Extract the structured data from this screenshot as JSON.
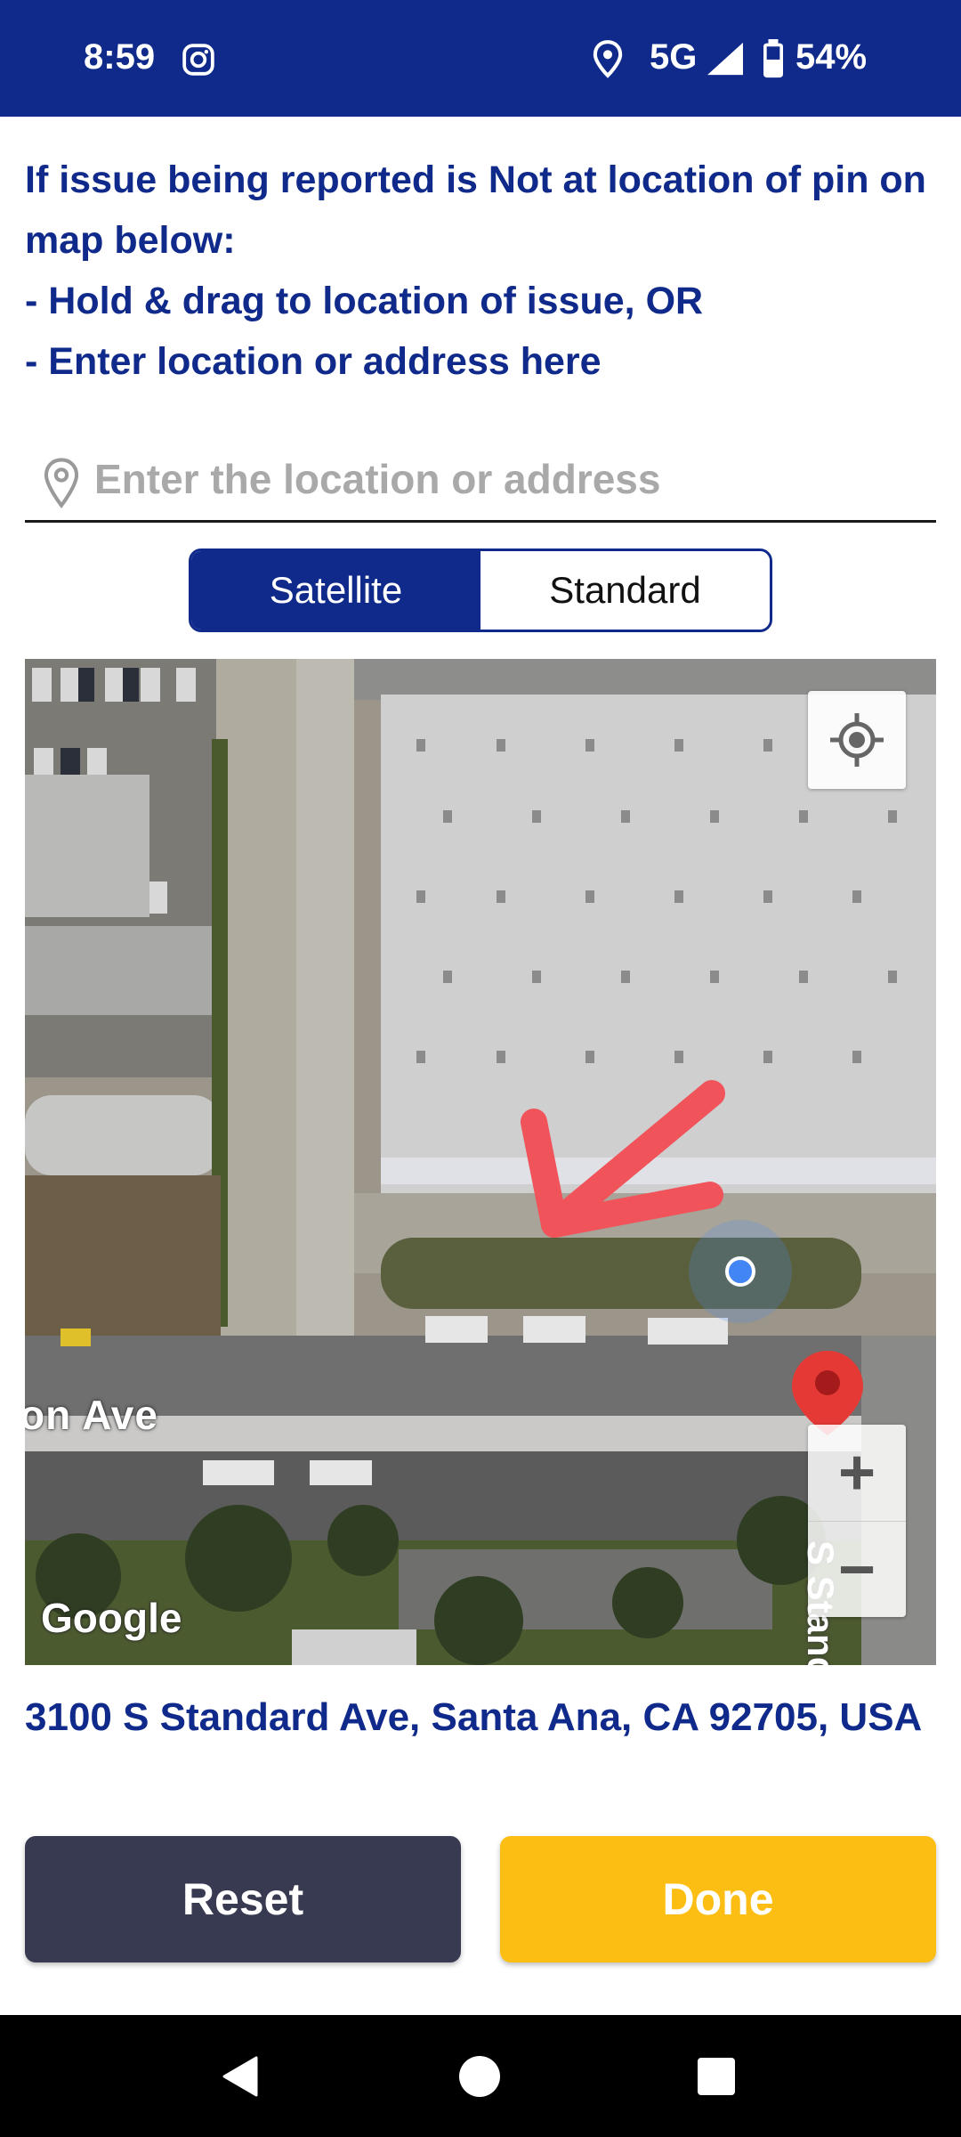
{
  "status_bar": {
    "time": "8:59",
    "network": "5G",
    "battery": "54%",
    "icons": [
      "instagram-icon",
      "location-icon",
      "signal-icon",
      "battery-icon"
    ]
  },
  "instructions": {
    "line1": "If issue being reported is Not at location of pin on map below:",
    "line2": "- Hold & drag to location of issue, OR",
    "line3": "- Enter location or address here"
  },
  "search": {
    "placeholder": "Enter the location or address",
    "value": ""
  },
  "map_toggle": {
    "options": [
      "Satellite",
      "Standard"
    ],
    "selected": "Satellite"
  },
  "map": {
    "street_label": "on Ave",
    "street_label_vertical": "S Standa",
    "attribution": "Google",
    "zoom_in_label": "+",
    "zoom_out_label": "−"
  },
  "address": "3100 S Standard Ave, Santa Ana, CA 92705, USA",
  "buttons": {
    "reset": "Reset",
    "done": "Done"
  },
  "colors": {
    "brand_blue": "#0f2a8a",
    "reset_bg": "#383a52",
    "done_bg": "#fcbe12",
    "pin_red": "#e53935",
    "arrow_annotation": "#f0545a"
  }
}
